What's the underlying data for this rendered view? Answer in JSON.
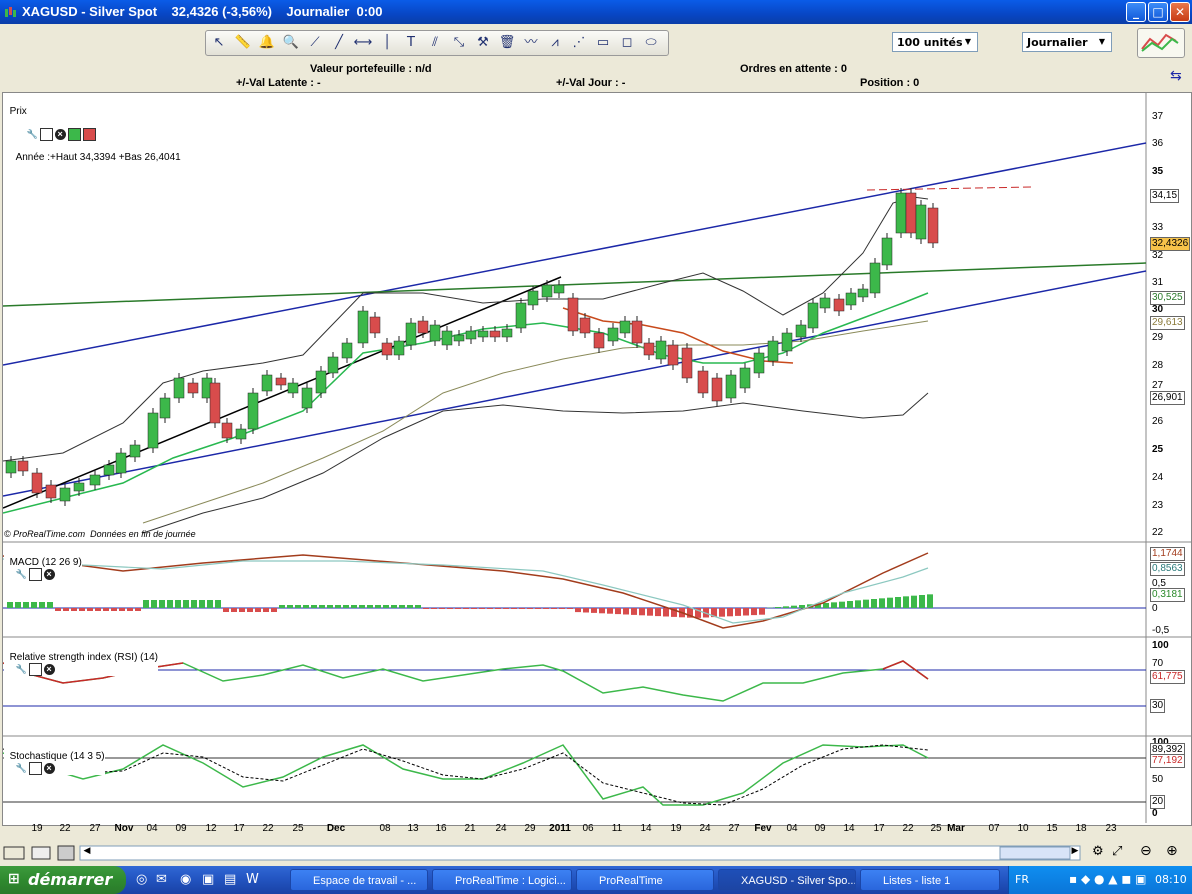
{
  "window": {
    "title": "XAGUSD - Silver Spot    32,4326 (-3,56%)    Journalier  0:00",
    "btn_min": "_",
    "btn_max": "□",
    "btn_close": "✕"
  },
  "toolbar": {
    "quantity_select": "100 unités",
    "period_select": "Journalier",
    "tools": [
      "cursor-icon",
      "ruler-icon",
      "alarm-icon",
      "zoom-icon",
      "line-icon",
      "trendline-icon",
      "horizontal-line-icon",
      "vertical-line-icon",
      "text-icon",
      "fibonacci-icon",
      "channel-icon",
      "tools-icon",
      "trash-icon",
      "indicator-icon",
      "pattern-icon",
      "fan-icon",
      "rectangle-icon",
      "shape-icon"
    ]
  },
  "portfolio": {
    "valeur": "Valeur portefeuille : n/d",
    "val_latente": "+/-Val Latente : -",
    "val_jour": "+/-Val Jour : -",
    "ordres": "Ordres en attente : 0",
    "position": "Position : 0"
  },
  "price_panel": {
    "label": "Prix",
    "info": "Année :+Haut 34,3394 +Bas 26,4041",
    "credit": "© ProRealTime.com  Données en fin de journée",
    "y_ticks": [
      "37",
      "36",
      "35",
      "34,15",
      "33",
      "32",
      "32,4326",
      "31",
      "30,525",
      "30",
      "29,613",
      "29",
      "28",
      "27",
      "26,901",
      "26",
      "25",
      "24",
      "23",
      "22"
    ],
    "last_price": "32,4326"
  },
  "macd_panel": {
    "label": "MACD (12 26 9)",
    "values": [
      "1,1744",
      "0,8563",
      "0,5",
      "0,3181",
      "0",
      "-0,5"
    ]
  },
  "rsi_panel": {
    "label": "Relative strength index (RSI) (14)",
    "values": [
      "100",
      "70",
      "61,775",
      "30"
    ]
  },
  "stoch_panel": {
    "label": "Stochastique (14 3 5)",
    "values": [
      "100",
      "89,392",
      "77,192",
      "50",
      "20",
      "0"
    ]
  },
  "x_axis": {
    "labels": [
      "19",
      "22",
      "27",
      "Nov",
      "04",
      "09",
      "12",
      "17",
      "22",
      "25",
      "Dec",
      "08",
      "13",
      "16",
      "21",
      "24",
      "29",
      "2011",
      "06",
      "11",
      "14",
      "19",
      "24",
      "27",
      "Fev",
      "04",
      "09",
      "14",
      "17",
      "22",
      "25",
      "Mar",
      "07",
      "10",
      "15",
      "18",
      "23"
    ]
  },
  "taskbar": {
    "start": "démarrer",
    "items": [
      "Espace de travail - ...",
      "ProRealTime : Logici...",
      "ProRealTime",
      "XAGUSD - Silver Spo...",
      "Listes - liste 1"
    ],
    "lang": "FR",
    "clock": "08:10"
  },
  "colors": {
    "up_candle": "#3cb84a",
    "down_candle": "#d84c4c",
    "channel": "#1c28a8",
    "green_line": "#2a7a2a",
    "titlebar": "#0a5ce8"
  }
}
